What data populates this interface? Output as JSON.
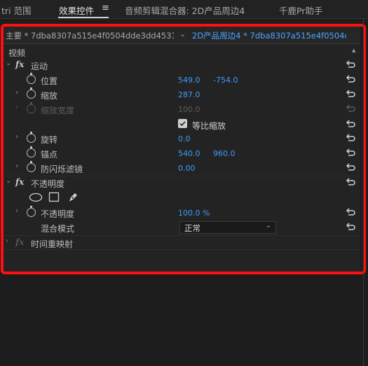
{
  "tabs": {
    "lumetri_partial": "tri 范围",
    "effect_controls": "效果控件",
    "menu_glyph": "≡",
    "audio_mixer": "音频剪辑混合器: 2D产品周边4",
    "assistant": "千鹿Pr助手"
  },
  "clip_header": {
    "master": "主要 * 7dba8307a515e4f0504dde3dd4531a84...",
    "sequence": "2D产品周边4 * 7dba8307a515e4f0504dd..."
  },
  "section_video": "视频",
  "motion": {
    "label": "运动",
    "position": {
      "label": "位置",
      "x": "549.0",
      "y": "-754.0"
    },
    "scale": {
      "label": "缩放",
      "value": "287.0"
    },
    "scale_width": {
      "label": "缩放宽度",
      "value": "100.0"
    },
    "uniform_scale": {
      "label": "等比缩放",
      "checked": true
    },
    "rotation": {
      "label": "旋转",
      "value": "0.0"
    },
    "anchor": {
      "label": "锚点",
      "x": "540.0",
      "y": "960.0"
    },
    "anti_flicker": {
      "label": "防闪烁滤镜",
      "value": "0.00"
    }
  },
  "opacity": {
    "label": "不透明度",
    "value_row": {
      "label": "不透明度",
      "value": "100.0 %"
    },
    "blend_mode": {
      "label": "混合模式",
      "value": "正常"
    }
  },
  "time_remap": {
    "label": "时间重映射"
  },
  "colors": {
    "accent_blue": "#3f9bff",
    "highlight_red": "#ff1010",
    "panel_bg": "#232323"
  }
}
